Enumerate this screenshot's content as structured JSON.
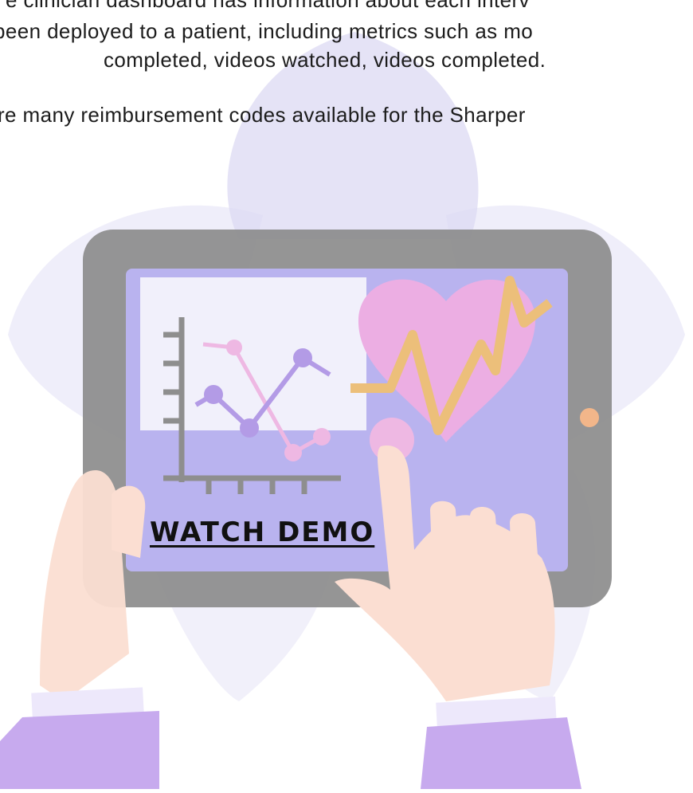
{
  "intro_text": {
    "line1": "e clinician dashboard has information about each interv",
    "line2": "been deployed to a patient, including metrics such as mo",
    "line3": "completed, videos watched, videos completed.",
    "line4": "re many reimbursement codes available for the Sharper"
  },
  "demo_link": {
    "label": "WATCH DEMO"
  },
  "colors": {
    "petal": "#dcd9f3",
    "tablet_frame": "#8c8c8c",
    "screen": "#b9b3ef",
    "chart_panel": "#f1f0fb",
    "heart": "#ecaee3",
    "pulse_line": "#ecbf7a",
    "chart_dots_purple": "#b39be6",
    "chart_dots_pink": "#eeb8e3",
    "hand": "#fbded2",
    "sleeve": "#c7aaee",
    "tablet_button": "#f2b68a"
  }
}
